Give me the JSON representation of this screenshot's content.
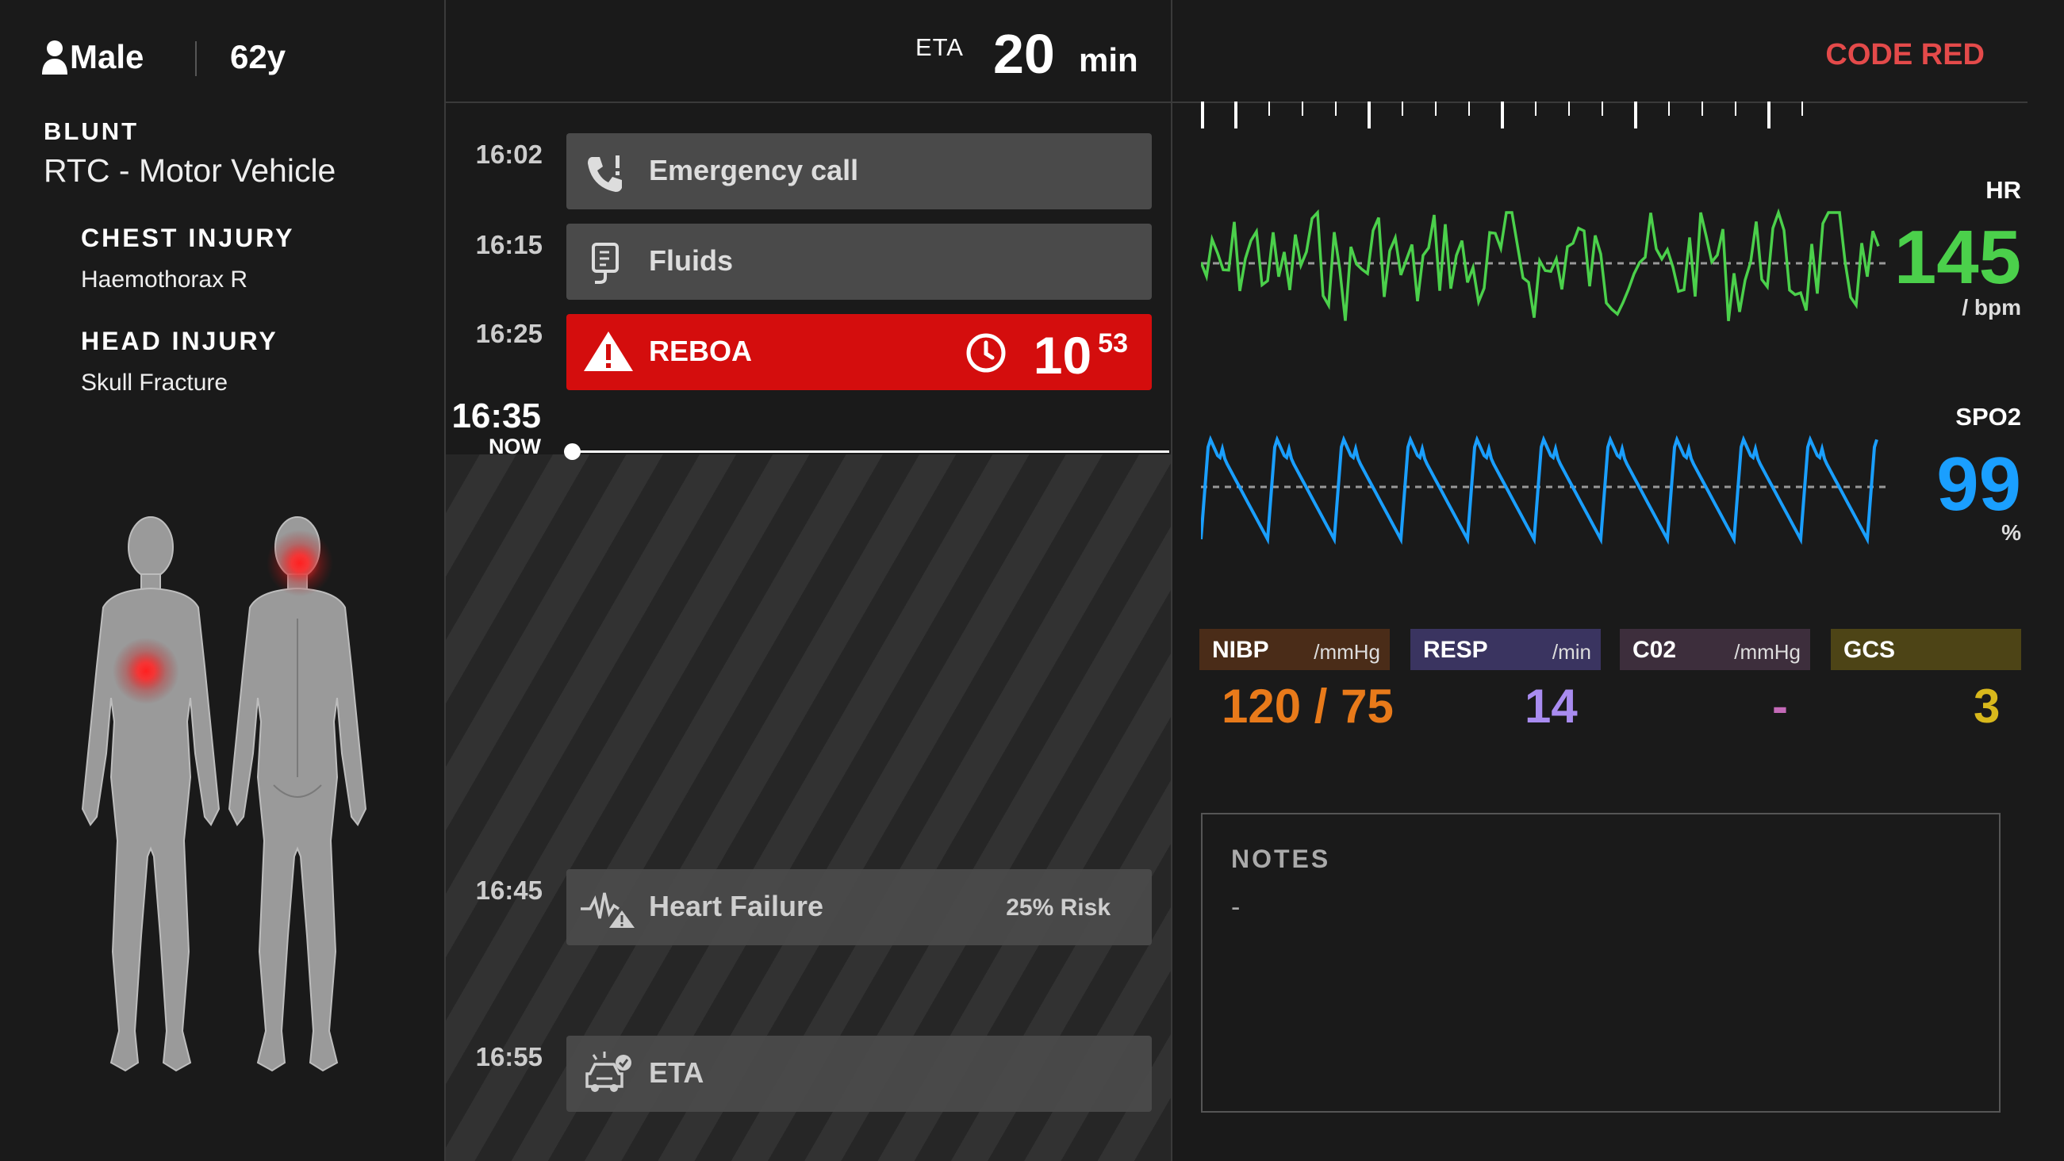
{
  "patient": {
    "sex": "Male",
    "age": "62y"
  },
  "mechanism": {
    "type": "BLUNT",
    "description": "RTC - Motor Vehicle"
  },
  "injuries": [
    {
      "title": "CHEST INJURY",
      "detail": "Haemothorax R"
    },
    {
      "title": "HEAD INJURY",
      "detail": "Skull Fracture"
    }
  ],
  "header": {
    "eta_label": "ETA",
    "eta_value": "20",
    "eta_unit": "min",
    "status": "CODE RED"
  },
  "timeline": {
    "now_time": "16:35",
    "now_label": "NOW",
    "events": [
      {
        "time": "16:02",
        "label": "Emergency call",
        "icon": "phone-alert-icon"
      },
      {
        "time": "16:15",
        "label": "Fluids",
        "icon": "iv-bag-icon"
      },
      {
        "time": "16:25",
        "label": "REBOA",
        "icon": "warning-icon",
        "timer_main": "10",
        "timer_sup": "53",
        "highlight_color": "#d40d0d"
      }
    ],
    "predictions": [
      {
        "time": "16:45",
        "label": "Heart Failure",
        "risk": "25% Risk",
        "icon": "heart-rate-warning-icon"
      },
      {
        "time": "16:55",
        "label": "ETA",
        "icon": "ambulance-check-icon"
      }
    ]
  },
  "vitals": {
    "hr": {
      "label": "HR",
      "value": "145",
      "unit": "/ bpm",
      "color": "#4bd04b"
    },
    "spo2": {
      "label": "SPO2",
      "value": "99",
      "unit": "%",
      "color": "#1a9fff"
    }
  },
  "tiles": [
    {
      "name": "NIBP",
      "unit": "/mmHg",
      "value": "120 / 75",
      "bg": "#4a2c18",
      "color": "#e87a1a"
    },
    {
      "name": "RESP",
      "unit": "/min",
      "value": "14",
      "bg": "#3a3460",
      "color": "#a98cf0"
    },
    {
      "name": "C02",
      "unit": "/mmHg",
      "value": "-",
      "bg": "#3d2e3c",
      "color": "#c46ab8"
    },
    {
      "name": "GCS",
      "unit": "",
      "value": "3",
      "bg": "#4d4416",
      "color": "#d8b81c"
    }
  ],
  "notes": {
    "title": "NOTES",
    "body": "-"
  }
}
